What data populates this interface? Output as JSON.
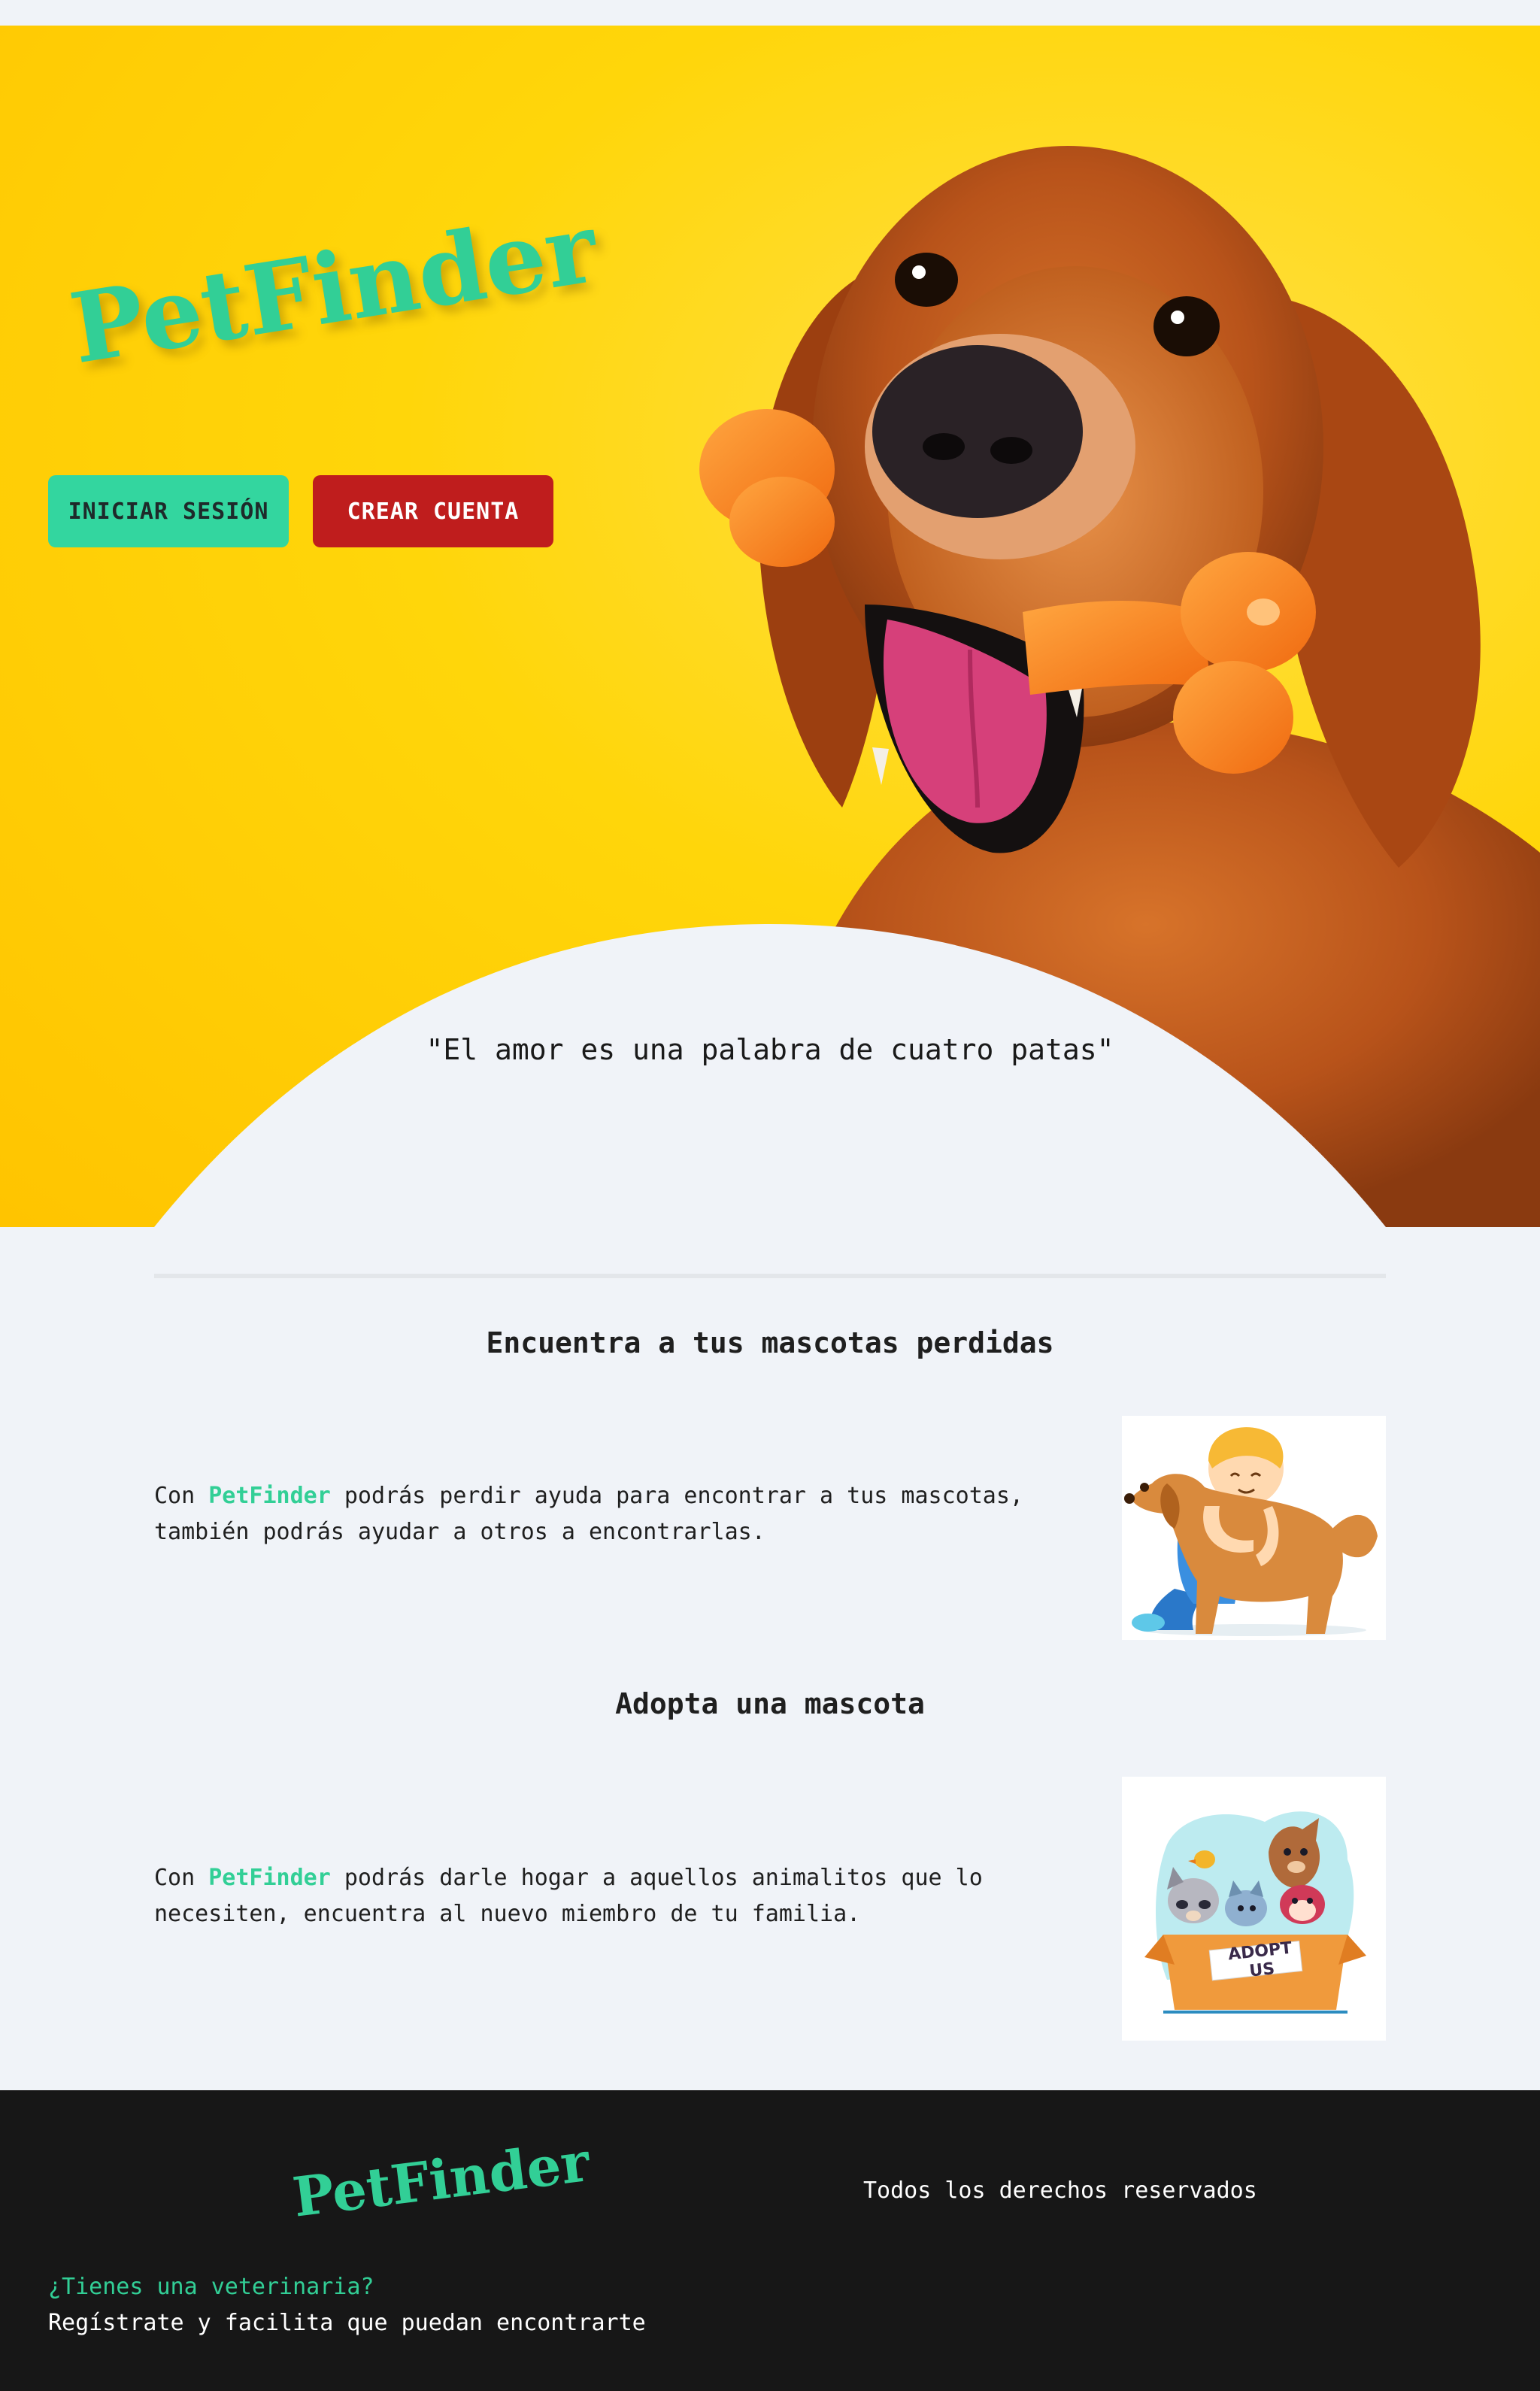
{
  "app": {
    "brand": "PetFinder"
  },
  "hero": {
    "login_label": "INICIAR SESIÓN",
    "signup_label": "CREAR CUENTA",
    "quote": "\"El amor es una palabra de cuatro patas\""
  },
  "sections": [
    {
      "title": "Encuentra a tus mascotas perdidas",
      "text_prefix": "Con ",
      "text_brand": "PetFinder",
      "text_suffix": " podrás perdir ayuda para encontrar a tus mascotas, también podrás ayudar a otros a encontrarlas.",
      "image_icon": "boy-hugging-dog-illustration"
    },
    {
      "title": "Adopta una mascota",
      "text_prefix": "Con ",
      "text_brand": "PetFinder",
      "text_suffix": " podrás darle hogar a aquellos animalitos que lo necesiten, encuentra al nuevo miembro de tu familia.",
      "image_icon": "adopt-box-illustration",
      "image_text": "ADOPT US"
    }
  ],
  "footer": {
    "rights": "Todos los derechos reservados",
    "question": "¿Tienes una veterinaria?",
    "cta": "Regístrate y facilita que puedan encontrarte"
  },
  "colors": {
    "accent": "#32cf96",
    "danger": "#bf1d1d",
    "hero_bg": "#ffd60a",
    "page_bg": "#f0f3f8",
    "footer_bg": "#171717"
  }
}
